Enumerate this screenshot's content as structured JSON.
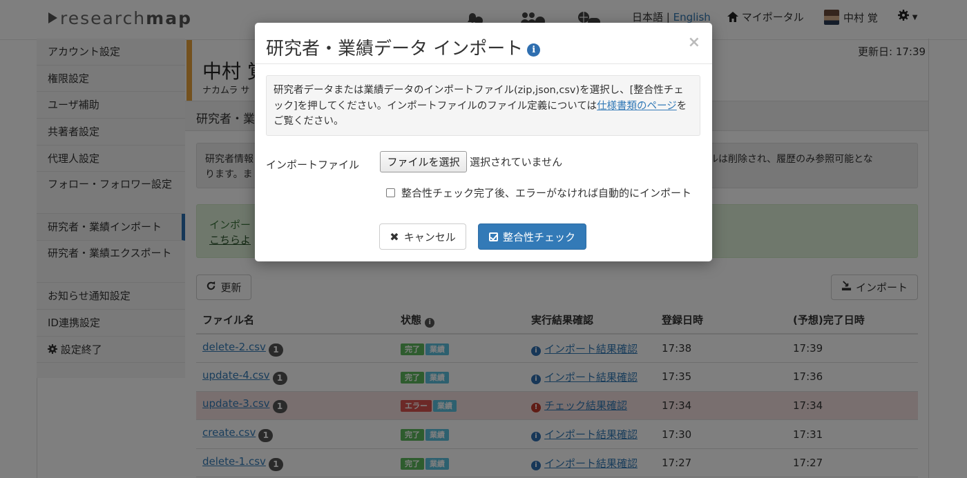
{
  "header": {
    "logo_a": "research",
    "logo_b": "map",
    "lang_ja": "日本語",
    "lang_sep": " | ",
    "lang_en": "English",
    "my_portal": "マイポータル",
    "user_name": "中村 覚"
  },
  "sidebar": {
    "items": [
      {
        "label": "アカウント設定"
      },
      {
        "label": "権限設定"
      },
      {
        "label": "ユーザ補助"
      },
      {
        "label": "共著者設定"
      },
      {
        "label": "代理人設定"
      },
      {
        "label": "フォロー・フォロワー設定"
      },
      {
        "label": "研究者・業績インポート"
      },
      {
        "label": "研究者・業績エクスポート"
      },
      {
        "label": "お知らせ通知設定"
      },
      {
        "label": "ID連携設定"
      },
      {
        "label": "設定終了"
      }
    ]
  },
  "main": {
    "name": "中村 覚",
    "name_kana": "ナカムラ サ",
    "updated": "更新日: 17:39",
    "section": "研究者・業",
    "info_text": "研究者情報… イルは削除され、履歴のみ参照可能となります。ま",
    "info_line1": "研究者情報",
    "info_line1_end": "イルは削除され、履歴のみ参照可能とな",
    "info_line2": "ります。ま",
    "success_line1": "インポー",
    "success_link": "こちらよ",
    "refresh": "更新",
    "import": "インポート"
  },
  "table": {
    "headers": [
      "ファイル名",
      "状態",
      "実行結果確認",
      "登録日時",
      "(予想)完了日時"
    ],
    "rows": [
      {
        "file": "delete-2.csv",
        "count": "1",
        "status": "完了",
        "category": "業績",
        "result": "インポート結果確認",
        "registered": "17:38",
        "completed": "17:39",
        "error": false
      },
      {
        "file": "update-4.csv",
        "count": "1",
        "status": "完了",
        "category": "業績",
        "result": "インポート結果確認",
        "registered": "17:35",
        "completed": "17:36",
        "error": false
      },
      {
        "file": "update-3.csv",
        "count": "1",
        "status": "エラー",
        "category": "業績",
        "result": "チェック結果確認",
        "registered": "17:34",
        "completed": "17:34",
        "error": true
      },
      {
        "file": "create.csv",
        "count": "1",
        "status": "完了",
        "category": "業績",
        "result": "インポート結果確認",
        "registered": "17:30",
        "completed": "17:31",
        "error": false
      },
      {
        "file": "delete-1.csv",
        "count": "1",
        "status": "完了",
        "category": "業績",
        "result": "インポート結果確認",
        "registered": "17:27",
        "completed": "17:27",
        "error": false
      }
    ]
  },
  "modal": {
    "title": "研究者・業績データ インポート",
    "close": "×",
    "desc_text": "研究者データまたは業績データのインポートファイル(zip,json,csv)を選択し、[整合性チェック]を押してください。インポートファイルのファイル定義については",
    "desc_link": "仕様書類のページ",
    "desc_tail": "をご覧ください。",
    "file_label": "インポートファイル",
    "file_button": "ファイルを選択",
    "file_none": "選択されていません",
    "auto_import": "整合性チェック完了後、エラーがなければ自動的にインポート",
    "cancel": "キャンセル",
    "check": "整合性チェック"
  },
  "colors": {
    "primary": "#337ab7",
    "success_label": "#5cb85c",
    "error_label": "#d9534f",
    "info_label": "#5bc0de",
    "accent_bar": "#e8a33c",
    "error_row": "#f2dede"
  },
  "icons": [
    "bell-icon",
    "users-icon",
    "globe-icon",
    "home-icon",
    "gear-icon",
    "info-icon",
    "refresh-icon",
    "import-icon",
    "close-icon",
    "check-square-icon"
  ]
}
